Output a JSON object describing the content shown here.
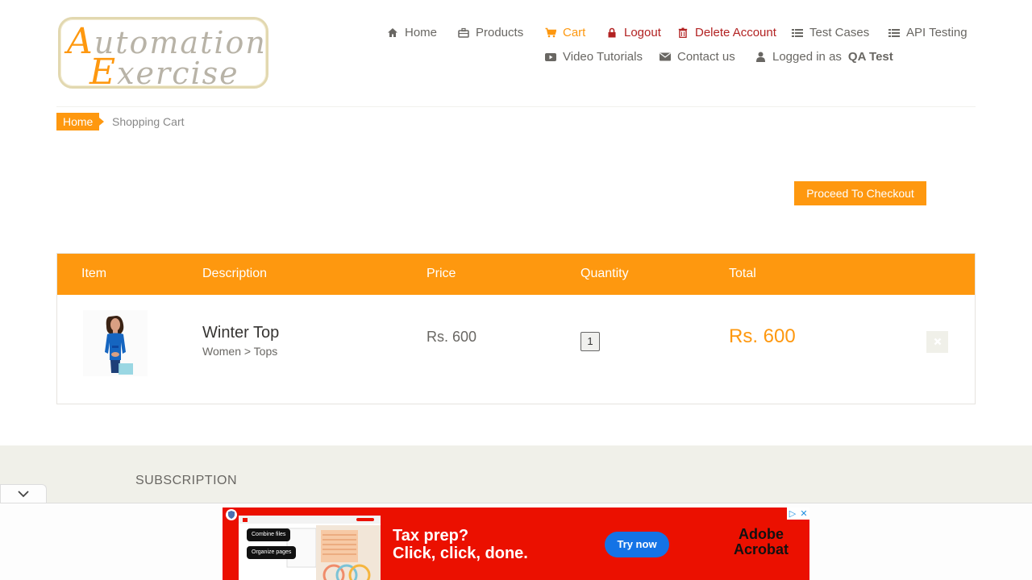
{
  "brand": {
    "logo_line1_cap": "A",
    "logo_line1_rest": "utomation",
    "logo_line2_cap": "E",
    "logo_line2_rest": "xercise",
    "accent_color": "#fe980f"
  },
  "nav": {
    "home": "Home",
    "products": "Products",
    "cart": "Cart",
    "logout": "Logout",
    "delete_account": "Delete Account",
    "test_cases": "Test Cases",
    "api_testing": "API Testing",
    "video_tutorials": "Video Tutorials",
    "contact_us": "Contact us",
    "logged_in_prefix": "Logged in as",
    "logged_in_user": "QA Test"
  },
  "breadcrumb": {
    "home": "Home",
    "current": "Shopping Cart"
  },
  "checkout": {
    "label": "Proceed To Checkout"
  },
  "cart": {
    "headers": {
      "item": "Item",
      "description": "Description",
      "price": "Price",
      "quantity": "Quantity",
      "total": "Total"
    },
    "rows": [
      {
        "name": "Winter Top",
        "category": "Women > Tops",
        "price": "Rs. 600",
        "quantity": "1",
        "total": "Rs. 600",
        "delete_icon": "close-icon"
      }
    ]
  },
  "footer": {
    "subscription": "SUBSCRIPTION"
  },
  "ad": {
    "chip1": "Combine files",
    "chip2": "Organize pages",
    "headline1": "Tax prep?",
    "headline2": "Click, click, done.",
    "cta": "Try now",
    "brand1": "Adobe",
    "brand2": "Acrobat",
    "background": "#eb1000"
  }
}
